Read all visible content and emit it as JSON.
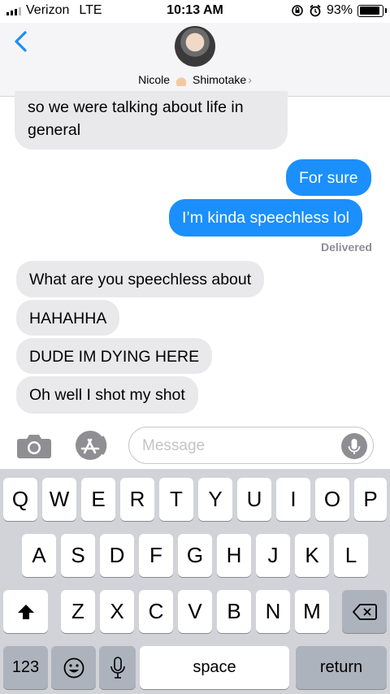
{
  "status_bar": {
    "carrier": "Verizon",
    "network": "LTE",
    "time": "10:13 AM",
    "battery": "93%",
    "battery_level": 0.93
  },
  "header": {
    "back_icon": "chevron-left-icon",
    "contact_first": "Nicole",
    "contact_last": "Shimotake",
    "contact_emoji": "finger-pointing-up-emoji",
    "chevron": "›"
  },
  "messages": [
    {
      "direction": "incoming",
      "text": "so we were talking about life in general"
    },
    {
      "direction": "outgoing",
      "text": "For sure"
    },
    {
      "direction": "outgoing",
      "text": "I’m kinda speechless lol"
    },
    {
      "direction": "incoming",
      "text": "What are you speechless about"
    },
    {
      "direction": "incoming",
      "text": "HAHAHHA"
    },
    {
      "direction": "incoming",
      "text": "DUDE IM DYING HERE"
    },
    {
      "direction": "incoming",
      "text": "Oh well I shot my shot"
    }
  ],
  "delivered_label": "Delivered",
  "composer": {
    "placeholder": "Message",
    "value": "",
    "camera_icon": "camera-icon",
    "apps_icon": "app-store-icon",
    "mic_icon": "microphone-icon"
  },
  "keyboard": {
    "row1": [
      "Q",
      "W",
      "E",
      "R",
      "T",
      "Y",
      "U",
      "I",
      "O",
      "P"
    ],
    "row2": [
      "A",
      "S",
      "D",
      "F",
      "G",
      "H",
      "J",
      "K",
      "L"
    ],
    "row3": [
      "Z",
      "X",
      "C",
      "V",
      "B",
      "N",
      "M"
    ],
    "numbers_label": "123",
    "space_label": "space",
    "return_label": "return",
    "shift_icon": "shift-icon",
    "delete_icon": "backspace-icon",
    "emoji_icon": "emoji-icon",
    "dictation_icon": "microphone-icon"
  },
  "colors": {
    "outgoing_bubble": "#1b8ffb",
    "incoming_bubble": "#e9e9eb",
    "keyboard_bg": "#d1d3d9"
  }
}
